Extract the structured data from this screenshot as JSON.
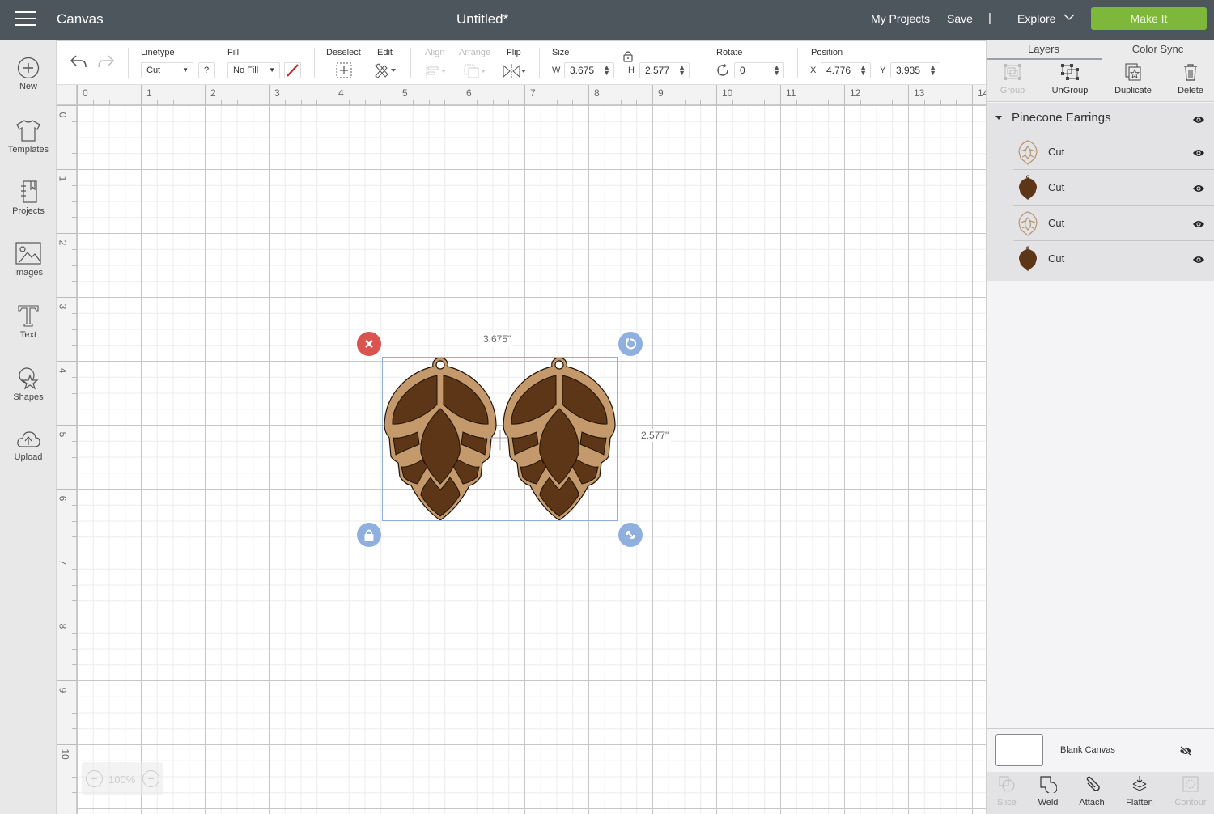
{
  "header": {
    "app_name": "Canvas",
    "doc_title": "Untitled*",
    "my_projects": "My Projects",
    "save": "Save",
    "separator": "|",
    "explore": "Explore",
    "make_it": "Make It",
    "make_it_color": "#7db83a",
    "bar_color": "#4d555d"
  },
  "sidebar": {
    "items": [
      {
        "label": "New",
        "icon": "plus-circle-icon"
      },
      {
        "label": "Templates",
        "icon": "tshirt-icon"
      },
      {
        "label": "Projects",
        "icon": "notebook-icon"
      },
      {
        "label": "Images",
        "icon": "image-icon"
      },
      {
        "label": "Text",
        "icon": "text-icon"
      },
      {
        "label": "Shapes",
        "icon": "shapes-icon"
      },
      {
        "label": "Upload",
        "icon": "cloud-upload-icon"
      }
    ]
  },
  "toolbar": {
    "linetype_label": "Linetype",
    "linetype_value": "Cut",
    "help": "?",
    "fill_label": "Fill",
    "fill_value": "No Fill",
    "deselect_label": "Deselect",
    "edit_label": "Edit",
    "align_label": "Align",
    "arrange_label": "Arrange",
    "flip_label": "Flip",
    "size_label": "Size",
    "w_label": "W",
    "w_value": "3.675",
    "h_label": "H",
    "h_value": "2.577",
    "rotate_label": "Rotate",
    "rotate_value": "0",
    "position_label": "Position",
    "x_label": "X",
    "x_value": "4.776",
    "y_label": "Y",
    "y_value": "3.935"
  },
  "rulers": {
    "horizontal": [
      "0",
      "1",
      "2",
      "3",
      "4",
      "5",
      "6",
      "7",
      "8",
      "9",
      "10",
      "11",
      "12",
      "13",
      "14"
    ],
    "vertical": [
      "0",
      "1",
      "2",
      "3",
      "4",
      "5",
      "6",
      "7",
      "8",
      "9",
      "10"
    ]
  },
  "canvas": {
    "width_label": "3.675\"",
    "height_label": "2.577\"",
    "zoom_level": "100%",
    "zoom_out": "−",
    "zoom_in": "+"
  },
  "panel": {
    "tabs": [
      "Layers",
      "Color Sync"
    ],
    "actions": [
      {
        "label": "Group",
        "enabled": false
      },
      {
        "label": "UnGroup",
        "enabled": true
      },
      {
        "label": "Duplicate",
        "enabled": true
      },
      {
        "label": "Delete",
        "enabled": true
      }
    ],
    "group_name": "Pinecone Earrings",
    "layers": [
      {
        "name": "Cut",
        "color": "#b89470",
        "style": "outline"
      },
      {
        "name": "Cut",
        "color": "#5c3617",
        "style": "solid"
      },
      {
        "name": "Cut",
        "color": "#b89470",
        "style": "outline"
      },
      {
        "name": "Cut",
        "color": "#5c3617",
        "style": "solid"
      }
    ],
    "blank_canvas": "Blank Canvas",
    "bottom_actions": [
      {
        "label": "Slice",
        "enabled": false
      },
      {
        "label": "Weld",
        "enabled": true
      },
      {
        "label": "Attach",
        "enabled": true
      },
      {
        "label": "Flatten",
        "enabled": true
      },
      {
        "label": "Contour",
        "enabled": false
      }
    ]
  },
  "design_colors": {
    "frame": "#c49a6c",
    "fill": "#5c3617",
    "stroke": "#1e1208"
  }
}
